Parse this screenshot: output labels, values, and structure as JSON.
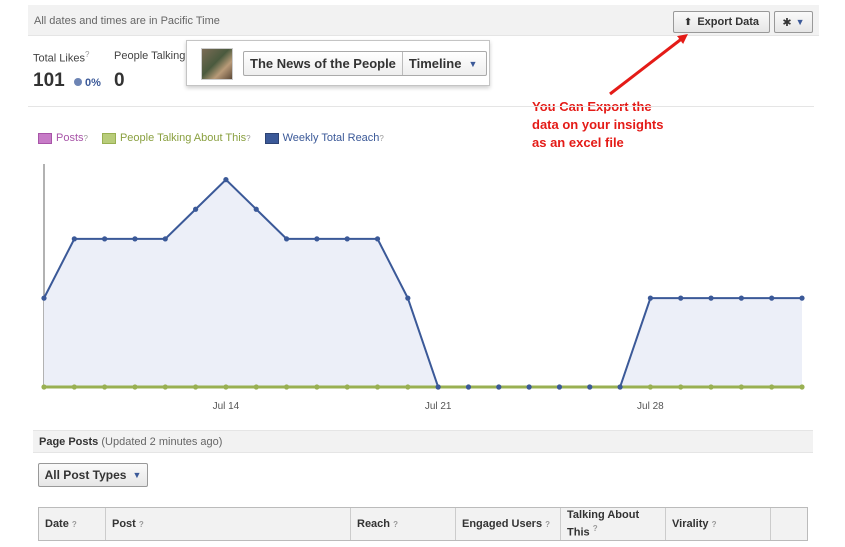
{
  "topbar": {
    "timezone_note": "All dates and times are in Pacific Time",
    "export_label": "Export Data",
    "export_icon": "upload-icon",
    "settings_icon": "gear-icon"
  },
  "stats": {
    "total_likes_label": "Total Likes",
    "total_likes_value": "101",
    "total_likes_change": "0%",
    "people_talking_label": "People Talking",
    "people_talking_value": "0"
  },
  "page_selector": {
    "page_name": "The News of the People",
    "view_label": "Timeline"
  },
  "annotation": {
    "lines": [
      "You Can Export the",
      "data on your insights",
      "as an excel file"
    ],
    "color": "#e41b17"
  },
  "legend": [
    {
      "label": "Posts",
      "color": "#a855a8"
    },
    {
      "label": "People Talking About This",
      "color": "#99b052"
    },
    {
      "label": "Weekly Total Reach",
      "color": "#3b5998"
    }
  ],
  "chart_data": {
    "type": "line",
    "x_labels": [
      {
        "index": 6,
        "label": "Jul 14"
      },
      {
        "index": 13,
        "label": "Jul 21"
      },
      {
        "index": 20,
        "label": "Jul 28"
      }
    ],
    "ylim": [
      0,
      4
    ],
    "grid": false,
    "series": [
      {
        "name": "Weekly Total Reach",
        "color": "#3b5998",
        "fill": "#eceff8",
        "values": [
          1.5,
          2.5,
          2.5,
          2.5,
          2.5,
          3,
          3.5,
          3,
          2.5,
          2.5,
          2.5,
          2.5,
          1.5,
          0,
          0,
          0,
          0,
          0,
          0,
          0,
          1.5,
          1.5,
          1.5,
          1.5,
          1.5,
          1.5
        ]
      },
      {
        "name": "People Talking About This",
        "color": "#99b052",
        "values": [
          0,
          0,
          0,
          0,
          0,
          0,
          0,
          0,
          0,
          0,
          0,
          0,
          0,
          0,
          0,
          0,
          0,
          0,
          0,
          0,
          0,
          0,
          0,
          0,
          0,
          0
        ]
      }
    ]
  },
  "page_posts": {
    "title": "Page Posts",
    "updated": "(Updated 2 minutes ago)",
    "filter_label": "All Post Types",
    "columns": [
      "Date",
      "Post",
      "Reach",
      "Engaged Users",
      "Talking About This",
      "Virality"
    ]
  }
}
